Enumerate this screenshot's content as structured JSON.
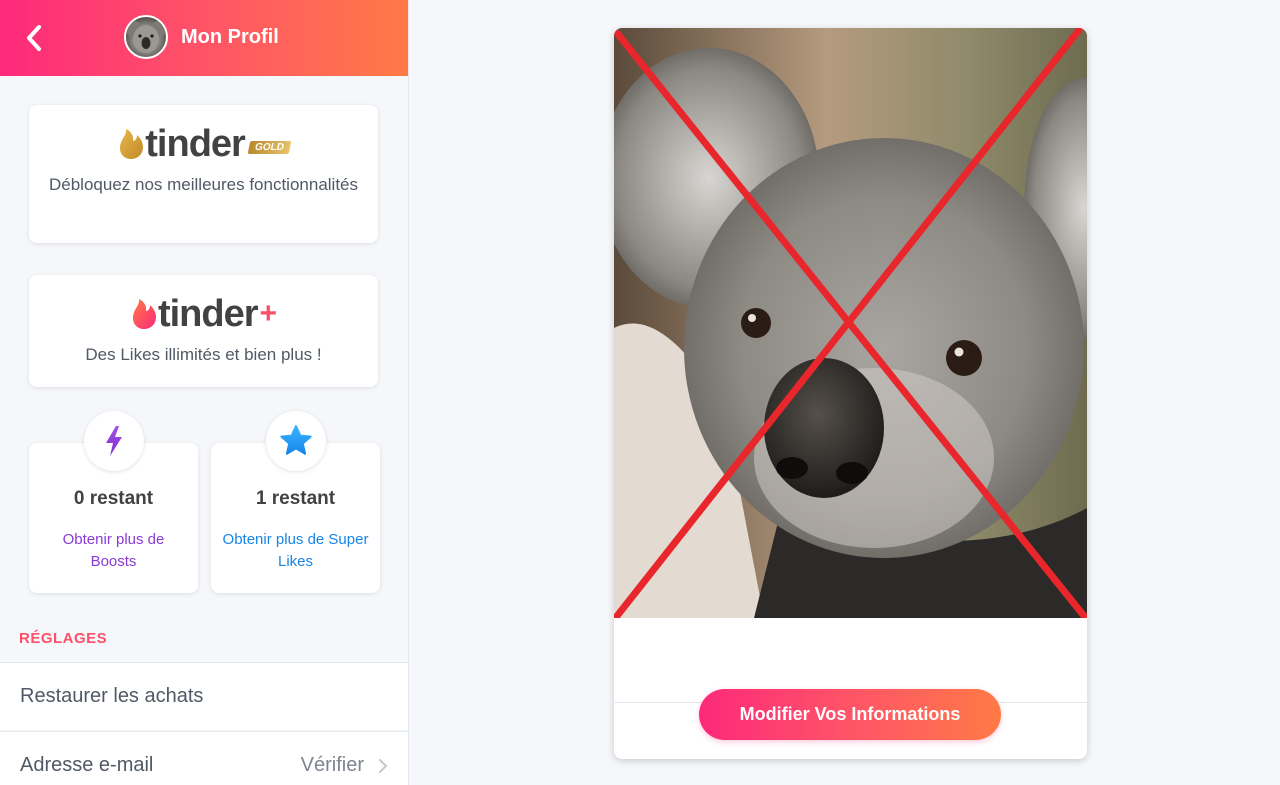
{
  "header": {
    "title": "Mon Profil"
  },
  "gold_card": {
    "brand": "tinder",
    "badge": "GOLD",
    "description": "Débloquez nos meilleures fonctionnalités"
  },
  "plus_card": {
    "brand": "tinder",
    "plus": "+",
    "description": "Des Likes illimités et bien plus !"
  },
  "boosts": {
    "count_label": "0 restant",
    "link": "Obtenir plus de Boosts"
  },
  "super_likes": {
    "count_label": "1 restant",
    "link": "Obtenir plus de Super Likes"
  },
  "settings": {
    "section_label": "RÉGLAGES",
    "restore_purchases": "Restaurer les achats",
    "email_label": "Adresse e-mail",
    "email_action": "Vérifier"
  },
  "profile": {
    "edit_button": "Modifier Vos Informations"
  },
  "colors": {
    "brand_gradient_start": "#fd297b",
    "brand_gradient_end": "#ff7a45",
    "accent": "#fd5068",
    "gold": "#c99a3a",
    "boost_purple": "#8a3bd6",
    "superlike_blue": "#1786e8",
    "cross_red": "#e8262b"
  },
  "icons": {
    "back": "chevron-left-icon",
    "gold_flame": "flame-icon",
    "plus_flame": "flame-icon",
    "boost": "lightning-bolt-icon",
    "super_like": "star-icon",
    "row_chevron": "chevron-right-icon"
  }
}
